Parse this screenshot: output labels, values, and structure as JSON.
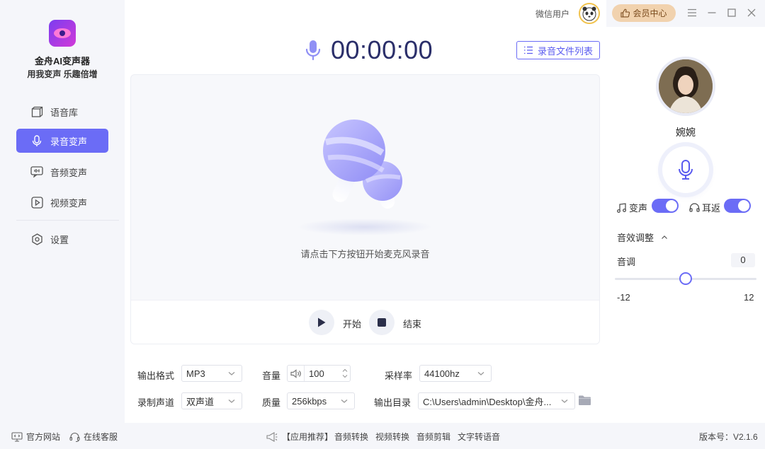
{
  "app": {
    "name": "金舟AI变声器",
    "slogan": "用我变声 乐趣倍增"
  },
  "topbar": {
    "user_name": "微信用户",
    "vip_label": "会员中心"
  },
  "sidebar": {
    "items": [
      {
        "label": "语音库",
        "icon": "cube-icon"
      },
      {
        "label": "录音变声",
        "icon": "microphone-icon",
        "active": true
      },
      {
        "label": "音频变声",
        "icon": "waveform-icon"
      },
      {
        "label": "视频变声",
        "icon": "play-icon"
      },
      {
        "label": "设置",
        "icon": "gear-icon"
      }
    ]
  },
  "recorder": {
    "timer": "00:00:00",
    "list_button": "录音文件列表",
    "hint": "请点击下方按钮开始麦克风录音",
    "start_label": "开始",
    "stop_label": "结束"
  },
  "options": {
    "format_label": "输出格式",
    "format_value": "MP3",
    "volume_label": "音量",
    "volume_value": "100",
    "sample_rate_label": "采样率",
    "sample_rate_value": "44100hz",
    "channel_label": "录制声道",
    "channel_value": "双声道",
    "quality_label": "质量",
    "quality_value": "256kbps",
    "output_dir_label": "输出目录",
    "output_dir_value": "C:\\Users\\admin\\Desktop\\金舟..."
  },
  "voice": {
    "name": "婉婉",
    "voice_change_label": "变声",
    "voice_change_on": true,
    "monitor_label": "耳返",
    "monitor_on": true,
    "fx_title": "音效调整",
    "pitch_label": "音调",
    "pitch_value": "0",
    "pitch_min": "-12",
    "pitch_max": "12",
    "pitch_fraction": 0.5
  },
  "footer": {
    "website": "官方网站",
    "support": "在线客服",
    "recommend": "【应用推荐】",
    "links": [
      "音频转换",
      "视频转换",
      "音频剪辑",
      "文字转语音"
    ],
    "version": "版本号：V2.1.6"
  },
  "colors": {
    "accent": "#6b6cf6",
    "timer_text": "#2b2f6a",
    "vip_bg": "#f1d2ae"
  }
}
